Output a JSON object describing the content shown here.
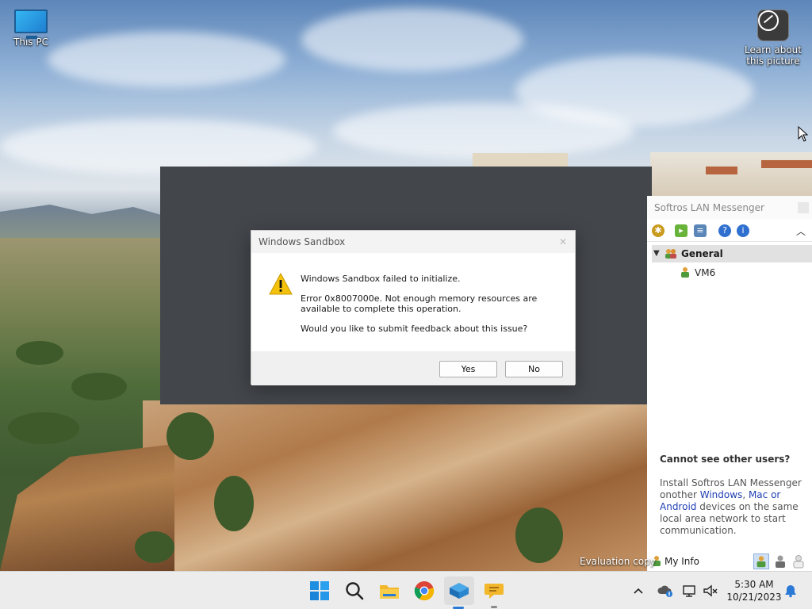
{
  "desktop": {
    "icons": [
      {
        "label": "This PC"
      },
      {
        "label": "Learn about this picture"
      }
    ],
    "evaluation_text": "Evaluation copy"
  },
  "dialog": {
    "title": "Windows Sandbox",
    "message_line1": "Windows Sandbox failed to initialize.",
    "message_line2": "Error 0x8007000e. Not enough memory resources are available to complete this operation.",
    "message_line3": "Would you like to submit feedback about this issue?",
    "yes_label": "Yes",
    "no_label": "No"
  },
  "messenger": {
    "title": "Softros LAN Messenger",
    "group_name": "General",
    "users": [
      {
        "name": "VM6"
      }
    ],
    "help_heading": "Cannot see other users?",
    "help_text_prefix": "Install Softros LAN Messenger onother ",
    "help_link_windows": "Windows",
    "help_sep1": ", ",
    "help_link_mac": "Mac",
    "help_sep2": " or ",
    "help_link_android": "Android",
    "help_text_suffix": " devices on the same local area network to start communication.",
    "my_info_label": "My Info"
  },
  "taskbar": {
    "time": "5:30 AM",
    "date": "10/21/2023",
    "apps": [
      {
        "icon": "windows-start-icon"
      },
      {
        "icon": "search-icon"
      },
      {
        "icon": "file-explorer-icon"
      },
      {
        "icon": "chrome-icon"
      },
      {
        "icon": "windows-sandbox-icon",
        "active": true
      },
      {
        "icon": "messenger-icon"
      }
    ]
  },
  "colors": {
    "sandbox_bg": "#43464b",
    "accent": "#2b7ad6",
    "warning": "#f4c20d",
    "link": "#1f3fb3"
  }
}
